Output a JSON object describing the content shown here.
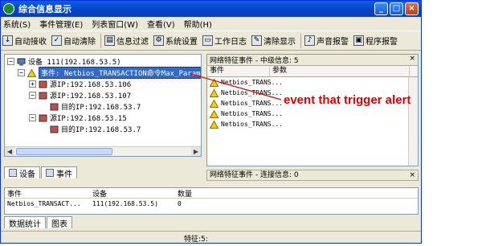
{
  "window": {
    "title": "综合信息显示",
    "buttons": {
      "minimize": "_",
      "maximize": "□",
      "close": "×"
    }
  },
  "menu": [
    "系统(S)",
    "事件管理(E)",
    "列表窗口(W)",
    "查看(V)",
    "帮助(H)"
  ],
  "toolbar": [
    "自动接收",
    "自动清除",
    "信息过滤",
    "系统设置",
    "工作日志",
    "清除显示",
    "声音报警",
    "程序报警"
  ],
  "tree": {
    "root": "设备 111(192.168.53.5)",
    "event": "事件: Netbios_TRANSACTION命令Max_Param",
    "children": [
      {
        "label": "源IP:192.168.53.106"
      },
      {
        "label": "源IP:192.168.53.107"
      },
      {
        "label": "目的IP:192.168.53.7"
      },
      {
        "label": "源IP:192.168.53.15"
      },
      {
        "label": "目的IP:192.168.53.7"
      }
    ]
  },
  "left_tabs": [
    "设备",
    "事件"
  ],
  "right_pane": {
    "header": "网络特征事件 - 中级信息: 5",
    "columns": [
      "事件",
      "参数"
    ],
    "rows": [
      "Netbios_TRANS...",
      "Netbios_TRANS...",
      "Netbios_TRANS...",
      "Netbios_TRANS...",
      "Netbios_TRANS..."
    ],
    "lower_header": "网络特征事件 - 连接信息: 0"
  },
  "bottom_pane": {
    "columns": [
      "事件",
      "设备",
      "数量"
    ],
    "row": [
      "Netbios_TRANSACT...",
      "111(192.168.53.5)",
      "0"
    ]
  },
  "bottom_tabs": [
    "数据统计",
    "图表"
  ],
  "status": "特征:5:",
  "annotation": "event that trigger alert",
  "colors": {
    "title_blue": "#0a5fe6",
    "selection": "#316ac5",
    "annotation_red": "#e00000",
    "warn_yellow": "#f5d000"
  }
}
